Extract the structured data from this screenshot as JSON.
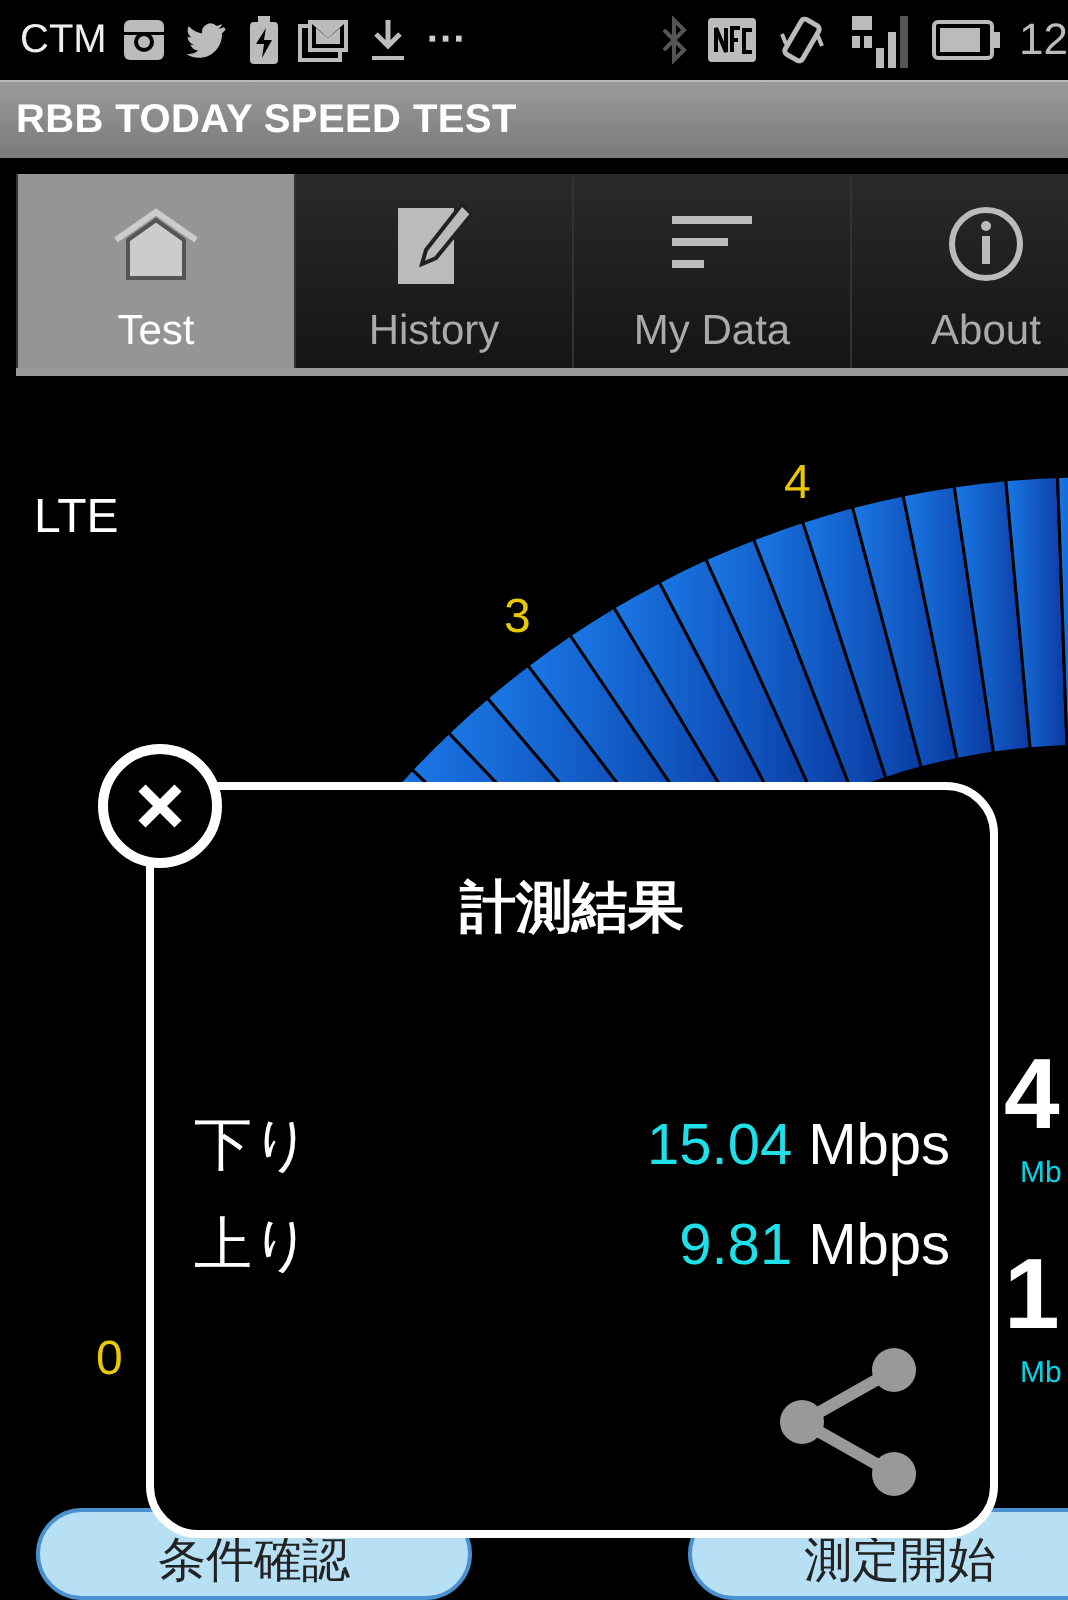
{
  "status_bar": {
    "carrier": "CTM",
    "overflow": "···",
    "time": "12"
  },
  "app_bar": {
    "title": "RBB TODAY SPEED TEST"
  },
  "tabs": [
    {
      "label": "Test",
      "selected": true
    },
    {
      "label": "History",
      "selected": false
    },
    {
      "label": "My Data",
      "selected": false
    },
    {
      "label": "About",
      "selected": false
    }
  ],
  "network": "LTE",
  "gauge": {
    "tick_labels": [
      "3",
      "4"
    ],
    "zero_label": "0",
    "readings": [
      {
        "value": "4",
        "unit": "Mb"
      },
      {
        "value": "1",
        "unit": "Mb"
      }
    ]
  },
  "buttons": [
    {
      "label": "条件確認"
    },
    {
      "label": "測定開始"
    }
  ],
  "dialog": {
    "title": "計測結果",
    "rows": [
      {
        "label": "下り",
        "value": "15.04",
        "unit": "Mbps"
      },
      {
        "label": "上り",
        "value": "9.81",
        "unit": "Mbps"
      }
    ]
  }
}
